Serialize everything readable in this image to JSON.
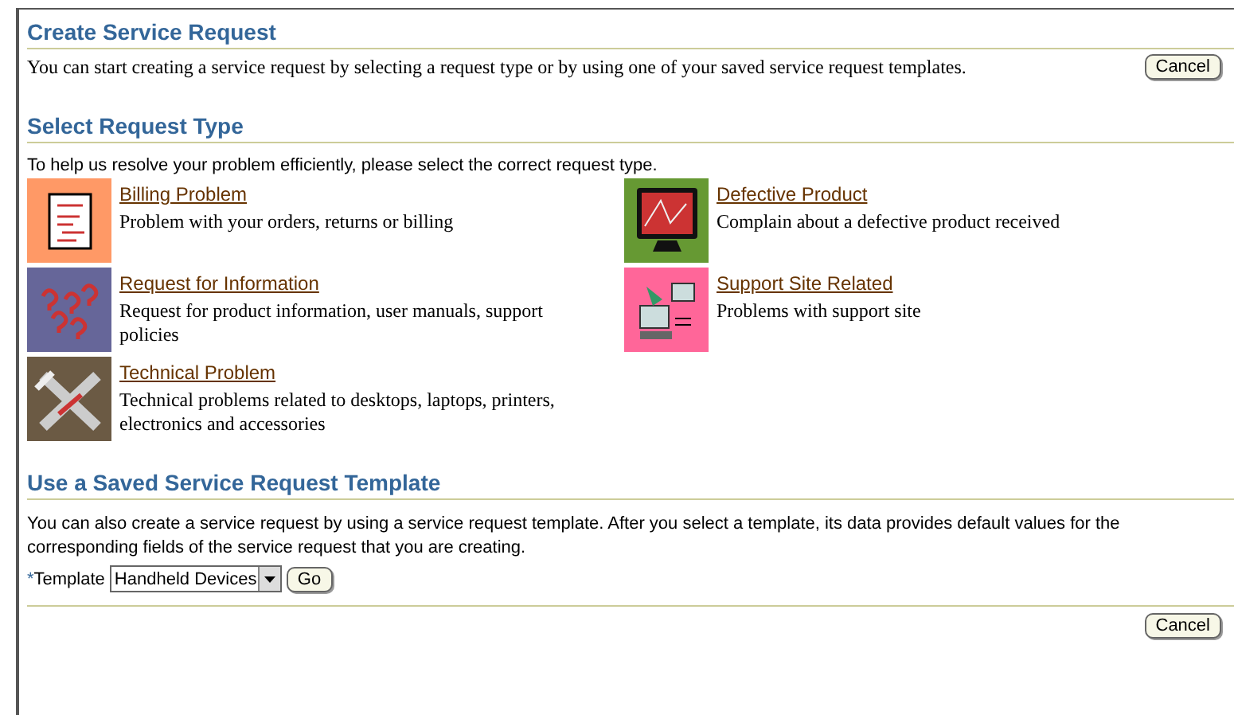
{
  "header": {
    "title": "Create Service Request",
    "description": "You can start creating a service request by selecting a request type or by using one of your saved service request templates.",
    "cancel": "Cancel"
  },
  "request_types": {
    "title": "Select Request Type",
    "instruction": "To help us resolve your problem efficiently, please select the correct request type.",
    "items": [
      {
        "kind": "bill",
        "color": "#ff9966",
        "label": "Billing Problem",
        "description": "Problem with your orders, returns or billing"
      },
      {
        "kind": "monitor",
        "color": "#669933",
        "label": "Defective Product",
        "description": "Complain about a defective product received"
      },
      {
        "kind": "questions",
        "color": "#666699",
        "label": "Request for Information",
        "description": "Request for product information, user manuals, support policies"
      },
      {
        "kind": "network",
        "color": "#ff6699",
        "label": "Support Site Related",
        "description": "Problems with support site"
      },
      {
        "kind": "tools",
        "color": "#6b5a44",
        "label": "Technical Problem",
        "description": "Technical problems related to desktops, laptops, printers, electronics and accessories"
      }
    ]
  },
  "template_section": {
    "title": "Use a Saved Service Request Template",
    "description": "You can also create a service request by using a service request template. After you select a template, its data provides default values for the corresponding fields of the service request that you are creating.",
    "required_mark": "*",
    "label": "Template",
    "value": "Handheld Devices",
    "go": "Go",
    "cancel": "Cancel"
  }
}
